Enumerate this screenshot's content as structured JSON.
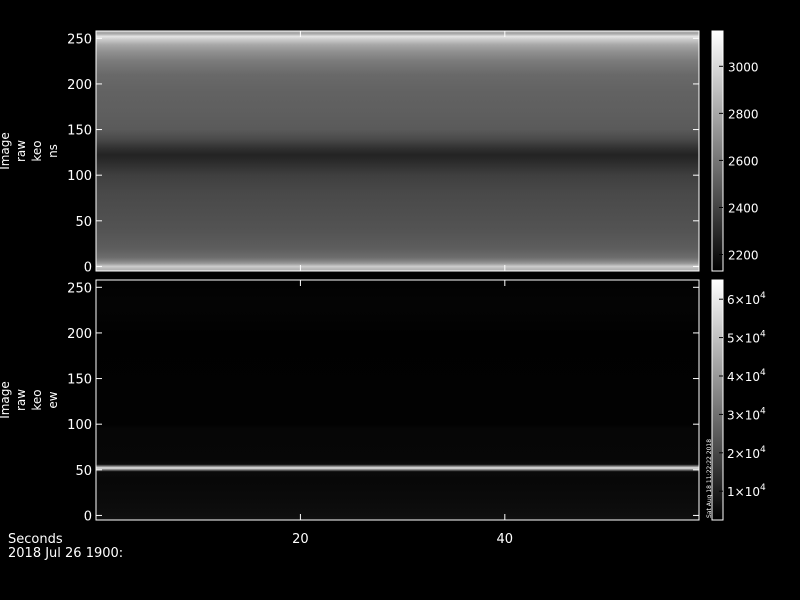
{
  "chart_data": [
    {
      "type": "heatmap",
      "panel": "ns",
      "ylabel": [
        "Image",
        "raw",
        "keo",
        "ns"
      ],
      "xlim": [
        0,
        59
      ],
      "ylim": [
        -5,
        258
      ],
      "y_ticks": [
        0,
        50,
        100,
        150,
        200,
        250
      ],
      "x_ticks": [
        20,
        40
      ],
      "colorbar": {
        "min": 2130,
        "max": 3150,
        "ticks": [
          {
            "value": 2200,
            "label": "2200"
          },
          {
            "value": 2400,
            "label": "2400"
          },
          {
            "value": 2600,
            "label": "2600"
          },
          {
            "value": 2800,
            "label": "2800"
          },
          {
            "value": 3000,
            "label": "3000"
          }
        ]
      },
      "row_profile": [
        [
          -3,
          2850
        ],
        [
          0,
          2950
        ],
        [
          3,
          2750
        ],
        [
          6,
          2650
        ],
        [
          10,
          2560
        ],
        [
          20,
          2500
        ],
        [
          40,
          2460
        ],
        [
          60,
          2440
        ],
        [
          80,
          2420
        ],
        [
          100,
          2380
        ],
        [
          115,
          2300
        ],
        [
          122,
          2270
        ],
        [
          130,
          2330
        ],
        [
          140,
          2430
        ],
        [
          150,
          2490
        ],
        [
          170,
          2510
        ],
        [
          190,
          2520
        ],
        [
          210,
          2550
        ],
        [
          225,
          2620
        ],
        [
          235,
          2700
        ],
        [
          243,
          2800
        ],
        [
          249,
          2950
        ],
        [
          252,
          3050
        ],
        [
          255,
          2800
        ]
      ]
    },
    {
      "type": "heatmap",
      "panel": "ew",
      "ylabel": [
        "Image",
        "raw",
        "keo",
        "ew"
      ],
      "xlim": [
        0,
        59
      ],
      "ylim": [
        -5,
        258
      ],
      "y_ticks": [
        0,
        50,
        100,
        150,
        200,
        250
      ],
      "x_ticks": [
        20,
        40
      ],
      "colorbar": {
        "min": 2500,
        "max": 65000,
        "ticks": [
          {
            "value": 10000,
            "base": "1×10",
            "exp": "4"
          },
          {
            "value": 20000,
            "base": "2×10",
            "exp": "4"
          },
          {
            "value": 30000,
            "base": "3×10",
            "exp": "4"
          },
          {
            "value": 40000,
            "base": "4×10",
            "exp": "4"
          },
          {
            "value": 50000,
            "base": "5×10",
            "exp": "4"
          },
          {
            "value": 60000,
            "base": "6×10",
            "exp": "4"
          }
        ]
      },
      "row_profile": [
        [
          -3,
          6500
        ],
        [
          0,
          6000
        ],
        [
          20,
          5000
        ],
        [
          40,
          4500
        ],
        [
          48,
          5200
        ],
        [
          52,
          60000
        ],
        [
          56,
          5000
        ],
        [
          60,
          4200
        ],
        [
          95,
          4000
        ],
        [
          100,
          3000
        ],
        [
          200,
          2800
        ],
        [
          215,
          3200
        ],
        [
          230,
          3600
        ],
        [
          245,
          3300
        ],
        [
          255,
          3000
        ]
      ]
    }
  ],
  "footer": {
    "xlabel": "Seconds",
    "date_line": "2018 Jul 26 1900:"
  },
  "stamp": "Sat Aug 18 11:22:22 2018"
}
